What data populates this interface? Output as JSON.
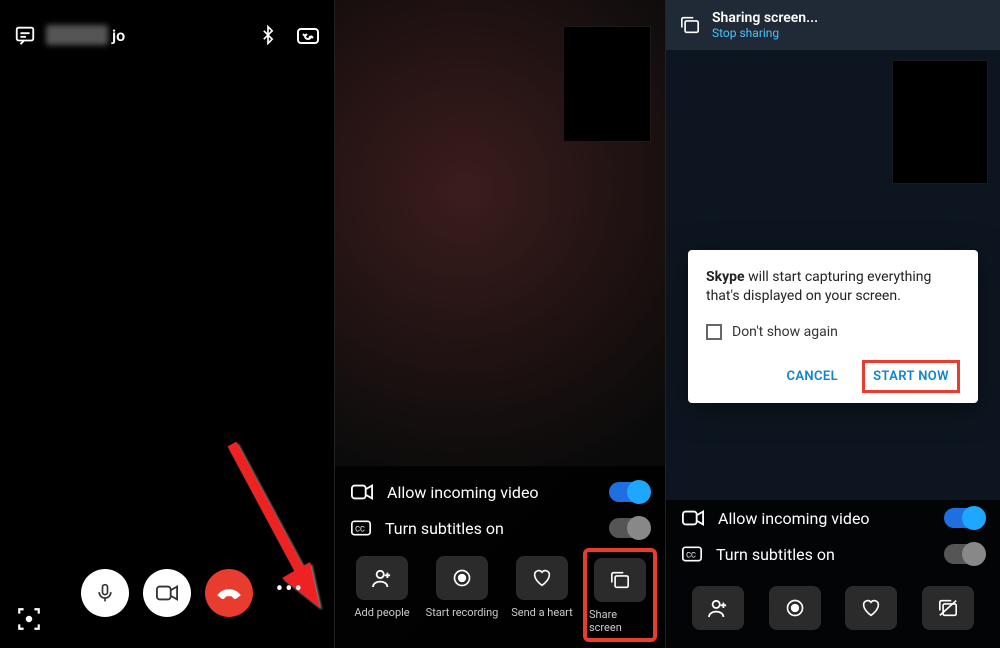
{
  "panel1": {
    "username_suffix": "jo"
  },
  "panel2": {
    "allow_incoming_video": "Allow incoming video",
    "turn_subtitles_on": "Turn subtitles on",
    "actions": {
      "add_people": "Add people",
      "start_recording": "Start recording",
      "send_a_heart": "Send a heart",
      "share_screen": "Share screen"
    }
  },
  "panel3": {
    "banner_title": "Sharing screen...",
    "banner_sub": "Stop sharing",
    "dialog": {
      "app_name": "Skype",
      "message_rest": " will start capturing everything that's displayed on your screen.",
      "dont_show": "Don't show again",
      "cancel": "CANCEL",
      "start_now": "START NOW"
    },
    "allow_incoming_video": "Allow incoming video",
    "turn_subtitles_on": "Turn subtitles on"
  }
}
